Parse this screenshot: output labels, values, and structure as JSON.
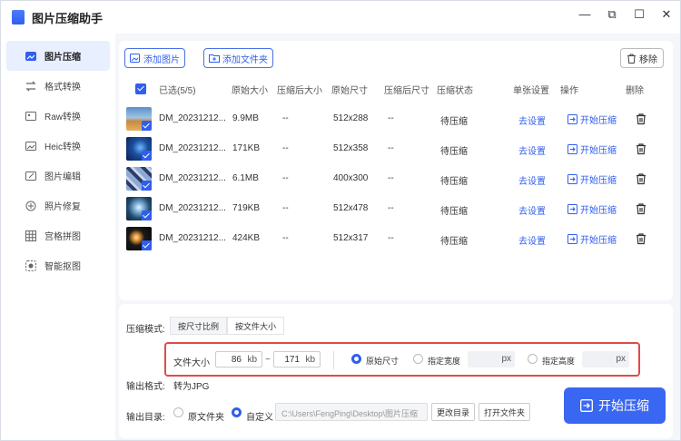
{
  "app": {
    "title": "图片压缩助手"
  },
  "window": {
    "min": "—",
    "restore": "⧉",
    "max": "☐",
    "close": "✕"
  },
  "sidebar": {
    "items": [
      {
        "label": "图片压缩",
        "icon": "compress-icon",
        "active": true
      },
      {
        "label": "格式转换",
        "icon": "convert-icon"
      },
      {
        "label": "Raw转换",
        "icon": "raw-icon"
      },
      {
        "label": "Heic转换",
        "icon": "heic-icon"
      },
      {
        "label": "图片编辑",
        "icon": "edit-icon"
      },
      {
        "label": "照片修复",
        "icon": "repair-icon"
      },
      {
        "label": "宫格拼图",
        "icon": "grid-icon"
      },
      {
        "label": "智能抠图",
        "icon": "cutout-icon"
      }
    ]
  },
  "toolbar": {
    "add_image": "添加图片",
    "add_folder": "添加文件夹",
    "remove": "移除"
  },
  "table": {
    "headers": {
      "selected": "已选(5/5)",
      "orig_size": "原始大小",
      "comp_size": "压缩后大小",
      "orig_dim": "原始尺寸",
      "comp_dim": "压缩后尺寸",
      "status": "压缩状态",
      "single_setting": "单张设置",
      "action": "操作",
      "delete": "删除"
    },
    "rows": [
      {
        "name": "DM_20231212...",
        "orig_size": "9.9MB",
        "comp_size": "--",
        "orig_dim": "512x288",
        "comp_dim": "--",
        "status": "待压缩",
        "setting": "去设置",
        "action": "开始压缩"
      },
      {
        "name": "DM_20231212...",
        "orig_size": "171KB",
        "comp_size": "--",
        "orig_dim": "512x358",
        "comp_dim": "--",
        "status": "待压缩",
        "setting": "去设置",
        "action": "开始压缩"
      },
      {
        "name": "DM_20231212...",
        "orig_size": "6.1MB",
        "comp_size": "--",
        "orig_dim": "400x300",
        "comp_dim": "--",
        "status": "待压缩",
        "setting": "去设置",
        "action": "开始压缩"
      },
      {
        "name": "DM_20231212...",
        "orig_size": "719KB",
        "comp_size": "--",
        "orig_dim": "512x478",
        "comp_dim": "--",
        "status": "待压缩",
        "setting": "去设置",
        "action": "开始压缩"
      },
      {
        "name": "DM_20231212...",
        "orig_size": "424KB",
        "comp_size": "--",
        "orig_dim": "512x317",
        "comp_dim": "--",
        "status": "待压缩",
        "setting": "去设置",
        "action": "开始压缩"
      }
    ]
  },
  "settings": {
    "mode_label": "压缩模式:",
    "mode_tabs": [
      "按尺寸比例",
      "按文件大小"
    ],
    "file_size_label": "文件大小",
    "min_value": "86",
    "max_value": "171",
    "unit_kb": "kb",
    "tilde": "~",
    "radio_original": "原始尺寸",
    "radio_width": "指定宽度",
    "radio_height": "指定高度",
    "unit_px": "px",
    "format_label": "输出格式:",
    "format_value": "转为JPG",
    "output_label": "输出目录:",
    "out_original": "原文件夹",
    "out_custom": "自定义",
    "path": "C:\\Users\\FengPing\\Desktop\\图片压缩",
    "change_dir": "更改目录",
    "open_folder": "打开文件夹",
    "start_all": "开始压缩"
  }
}
